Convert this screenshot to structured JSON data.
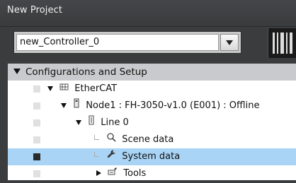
{
  "window": {
    "title": "New Project"
  },
  "controller_select": {
    "value": "new_Controller_0"
  },
  "tree": {
    "header": "Configurations and Setup",
    "rows": [
      {
        "label": "EtherCAT",
        "icon": "ethercat-icon",
        "expander": "expanded"
      },
      {
        "label": "Node1 : FH-3050-v1.0 (E001) : Offline",
        "icon": "device-icon",
        "expander": "expanded"
      },
      {
        "label": "Line 0",
        "icon": "line-icon",
        "expander": "expanded"
      },
      {
        "label": "Scene data",
        "icon": "scene-data-icon",
        "expander": "none"
      },
      {
        "label": "System data",
        "icon": "wrench-icon",
        "expander": "none",
        "selected": true
      },
      {
        "label": "Tools",
        "icon": "tools-icon",
        "expander": "collapsed"
      }
    ]
  },
  "colors": {
    "selection": "#a9d4f5",
    "header_bg": "#c9cacd",
    "window_bg": "#3b3c3e"
  }
}
